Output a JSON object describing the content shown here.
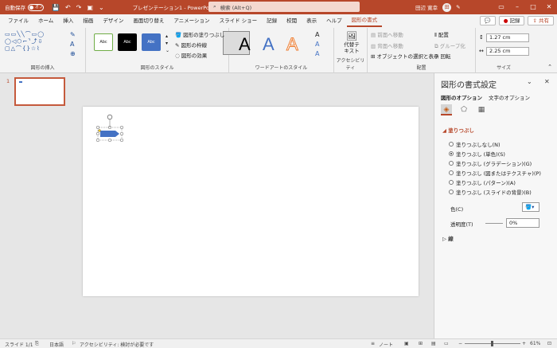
{
  "titlebar": {
    "autosave_label": "自動保存",
    "autosave_state": "オフ",
    "doc_title": "プレゼンテーション1 - PowerPoint",
    "search_placeholder": "検索 (Alt+Q)",
    "user_name": "田辺 寛幸",
    "user_initials": "田",
    "colors": {
      "bar": "#b7472a",
      "search_bg": "#f4d8cf"
    }
  },
  "tabs": {
    "items": [
      "ファイル",
      "ホーム",
      "挿入",
      "描画",
      "デザイン",
      "画面切り替え",
      "アニメーション",
      "スライド ショー",
      "記録",
      "校閲",
      "表示",
      "ヘルプ",
      "図形の書式"
    ],
    "active": "図形の書式",
    "record_label": "記録",
    "share_label": "共有"
  },
  "ribbon": {
    "groups": {
      "insert_shapes": "図形の挿入",
      "shape_styles": "図形のスタイル",
      "wordart_styles": "ワードアートのスタイル",
      "accessibility": "アクセシビリティ",
      "arrange": "配置",
      "size": "サイズ"
    },
    "style_sample_text": "Abc",
    "fill_label": "図形の塗りつぶし",
    "outline_label": "図形の枠線",
    "effects_label": "図形の効果",
    "alt_text_label": "代替テ\nキスト",
    "bring_forward": "前面へ移動",
    "send_backward": "背面へ移動",
    "selection_pane": "オブジェクトの選択と表示",
    "align_label": "配置",
    "group_label": "グループ化",
    "rotate_label": "回転",
    "height_value": "1.27 cm",
    "width_value": "2.25 cm"
  },
  "thumbnails": {
    "slide_number": "1"
  },
  "format_pane": {
    "title": "図形の書式設定",
    "tab_shape": "図形のオプション",
    "tab_text": "文字のオプション",
    "fill_section": "塗りつぶし",
    "fill_options": [
      "塗りつぶしなし(N)",
      "塗りつぶし (単色)(S)",
      "塗りつぶし (グラデーション)(G)",
      "塗りつぶし (図またはテクスチャ)(P)",
      "塗りつぶし (パターン)(A)",
      "塗りつぶし (スライドの背景)(B)"
    ],
    "selected_fill_index": 1,
    "color_label": "色(C)",
    "transparency_label": "透明度(T)",
    "transparency_value": "0%",
    "line_section": "線"
  },
  "statusbar": {
    "slide_info": "スライド 1/1",
    "language": "日本語",
    "accessibility": "アクセシビリティ: 検討が必要です",
    "notes_label": "ノート",
    "zoom": "61%"
  },
  "shape_color": "#4472c4"
}
